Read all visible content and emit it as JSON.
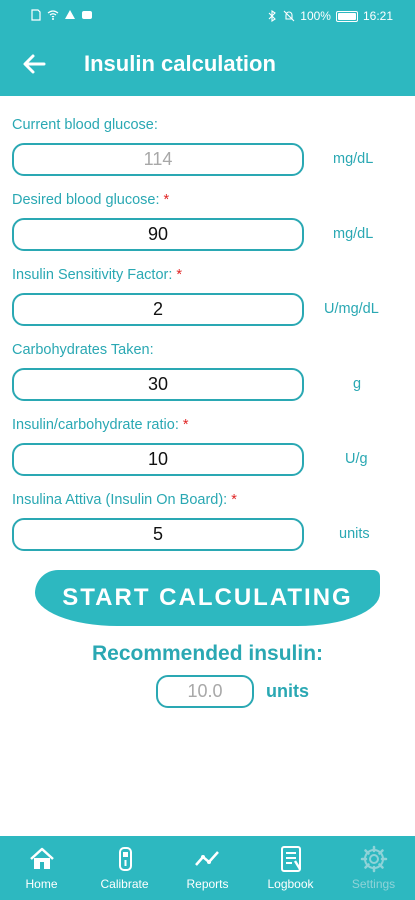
{
  "status_bar": {
    "battery": "100%",
    "time": "16:21"
  },
  "header": {
    "title": "Insulin calculation"
  },
  "fields": {
    "current_glucose": {
      "label": "Current blood glucose:",
      "placeholder": "114",
      "unit": "mg/dL"
    },
    "desired_glucose": {
      "label": "Desired blood glucose:",
      "required": "*",
      "value": "90",
      "unit": "mg/dL"
    },
    "sensitivity": {
      "label": "Insulin Sensitivity Factor:",
      "required": "*",
      "value": "2",
      "unit": "U/mg/dL"
    },
    "carbs": {
      "label": "Carbohydrates Taken:",
      "value": "30",
      "unit": "g"
    },
    "ratio": {
      "label": "Insulin/carbohydrate ratio:",
      "required": "*",
      "value": "10",
      "unit": "U/g"
    },
    "iob": {
      "label": "Insulina Attiva (Insulin On Board):",
      "required": "*",
      "value": "5",
      "unit": "units"
    }
  },
  "calculate_button": "START CALCULATING",
  "result": {
    "label": "Recommended insulin:",
    "placeholder": "10.0",
    "unit": "units"
  },
  "nav": {
    "home": "Home",
    "calibrate": "Calibrate",
    "reports": "Reports",
    "logbook": "Logbook",
    "settings": "Settings"
  }
}
